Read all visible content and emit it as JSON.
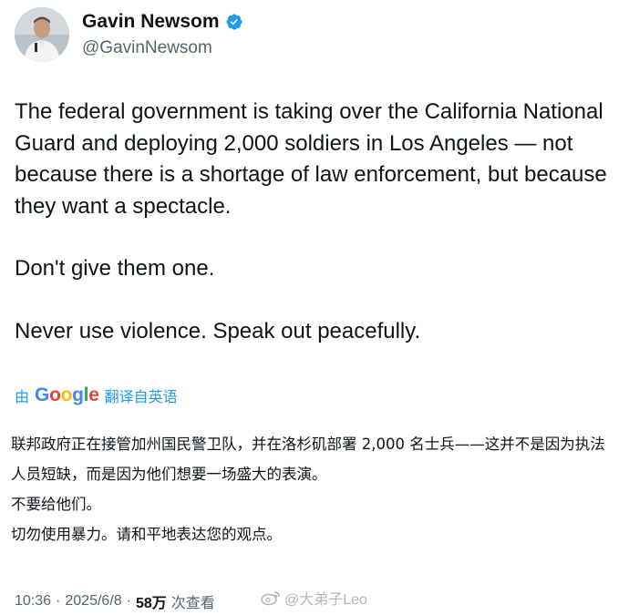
{
  "author": {
    "display_name": "Gavin Newsom",
    "handle": "@GavinNewsom"
  },
  "tweet": {
    "paragraphs": [
      "The federal government is taking over the California National Guard and deploying 2,000 soldiers in Los Angeles — not because there is a shortage of law enforcement, but because they want a spectacle.",
      "Don't give them one.",
      "Never use violence. Speak out peacefully."
    ]
  },
  "translation": {
    "by_label": "由",
    "provider": "Google",
    "label": "翻译自英语",
    "paragraphs": [
      "联邦政府正在接管加州国民警卫队，并在洛杉矶部署 2,000 名士兵——这并不是因为执法人员短缺，而是因为他们想要一场盛大的表演。",
      "不要给他们。",
      "切勿使用暴力。请和平地表达您的观点。"
    ]
  },
  "meta": {
    "time": "10:36",
    "separator": "·",
    "date": "2025/6/8",
    "views_count": "58万",
    "views_label": "次查看"
  },
  "watermark": {
    "text": "@大弟子Leo"
  },
  "colors": {
    "link_blue": "#1d9bf0",
    "secondary_text": "#536471",
    "verified_badge": "#1d9bf0"
  }
}
